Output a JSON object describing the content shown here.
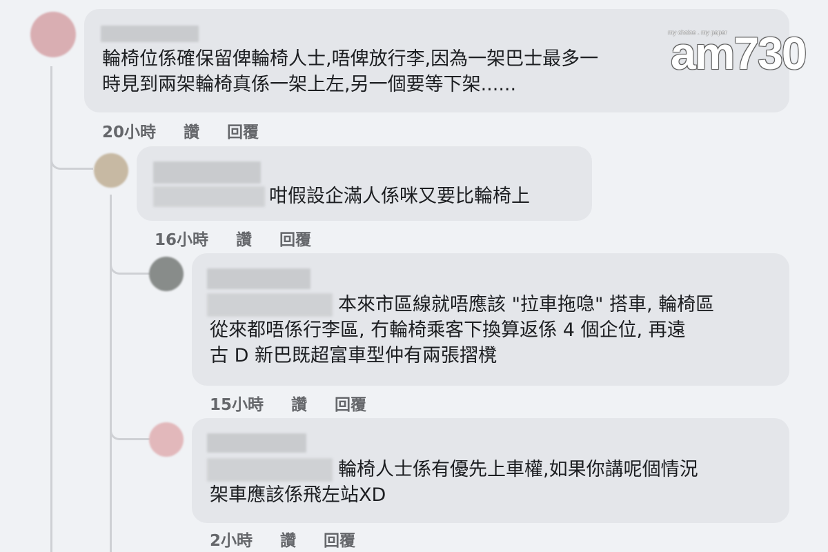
{
  "watermark": {
    "brand": "am730",
    "tagline": "my choice . my paper"
  },
  "comments": [
    {
      "text_lines": [
        "輪椅位係確保留俾輪椅人士,唔俾放行李,因為一架巴士最多一",
        "時見到兩架輪椅真係一架上左,另一個要等下架......"
      ],
      "time": "20小時",
      "like": "讚",
      "reply": "回覆",
      "avatar_color": "#d9aeb2"
    },
    {
      "text_lines": [
        "咁假設企滿人係咪又要比輪椅上"
      ],
      "time": "16小時",
      "like": "讚",
      "reply": "回覆",
      "avatar_color": "#c7b9a3"
    },
    {
      "text_lines": [
        "本來市區線就唔應該 \"拉車拖喼\" 搭車, 輪椅區",
        "從來都唔係行李區, 冇輪椅乘客下換算返係 4 個企位, 再遠",
        "古 D 新巴既超富車型仲有兩張摺櫈"
      ],
      "time": "15小時",
      "like": "讚",
      "reply": "回覆",
      "avatar_color": "#888c8a"
    },
    {
      "text_lines": [
        "輪椅人士係有優先上車權,如果你講呢個情況",
        "架車應該係飛左站XD"
      ],
      "time": "2小時",
      "like": "讚",
      "reply": "回覆",
      "avatar_color": "#e2b8bb"
    }
  ]
}
